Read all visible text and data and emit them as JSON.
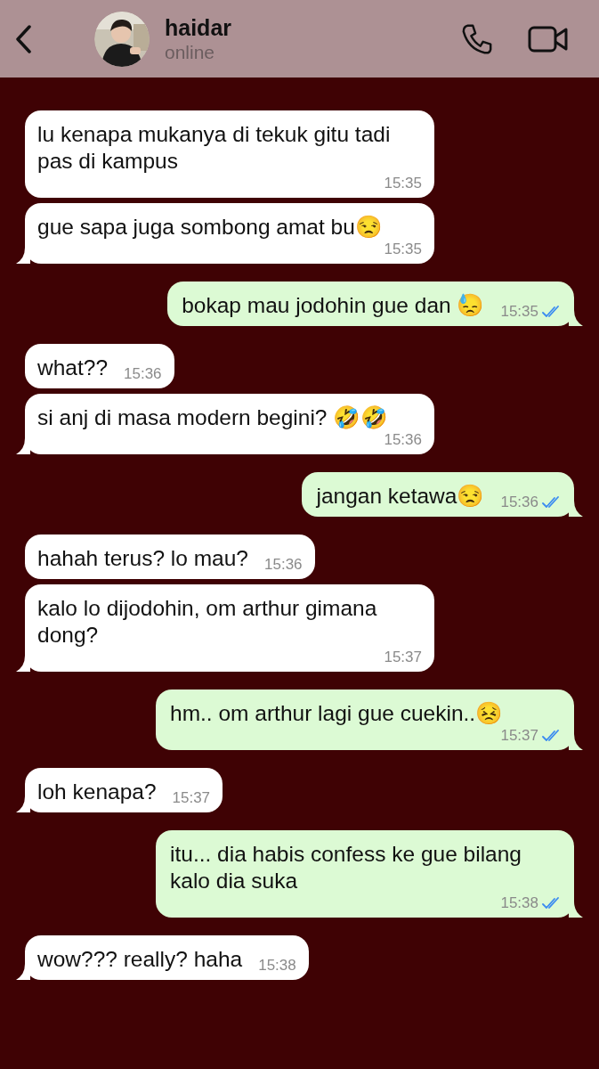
{
  "header": {
    "name": "haidar",
    "status": "online"
  },
  "messages": [
    {
      "kind": "in",
      "text": "lu kenapa mukanya di tekuk gitu tadi pas di kampus",
      "time": "15:35",
      "tail": false
    },
    {
      "kind": "in",
      "text": "gue sapa juga sombong amat bu😒",
      "time": "15:35",
      "tail": true
    },
    {
      "kind": "out",
      "text": "bokap mau jodohin gue dan 😓",
      "time": "15:35",
      "read": true,
      "tail": true
    },
    {
      "kind": "in",
      "text": "what??",
      "time": "15:36",
      "tail": false
    },
    {
      "kind": "in",
      "text": "si anj di masa modern begini? 🤣🤣",
      "time": "15:36",
      "tail": true
    },
    {
      "kind": "out",
      "text": "jangan ketawa😒",
      "time": "15:36",
      "read": true,
      "tail": true
    },
    {
      "kind": "in",
      "text": "hahah terus? lo mau?",
      "time": "15:36",
      "tail": false
    },
    {
      "kind": "in",
      "text": "kalo lo dijodohin, om arthur gimana dong?",
      "time": "15:37",
      "tail": true
    },
    {
      "kind": "out",
      "text": "hm.. om arthur lagi gue cuekin..😣",
      "time": "15:37",
      "read": true,
      "tail": true
    },
    {
      "kind": "in",
      "text": "loh kenapa?",
      "time": "15:37",
      "tail": true
    },
    {
      "kind": "out",
      "text": "itu... dia habis confess ke gue bilang kalo dia suka",
      "time": "15:38",
      "read": true,
      "tail": true
    },
    {
      "kind": "in",
      "text": "wow??? really? haha",
      "time": "15:38",
      "tail": true
    }
  ]
}
